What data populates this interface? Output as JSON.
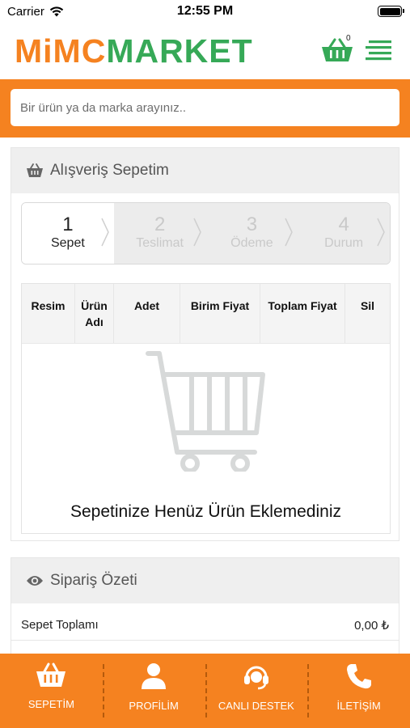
{
  "status_bar": {
    "carrier": "Carrier",
    "time": "12:55 PM"
  },
  "header": {
    "logo": {
      "part1": "MiMC",
      "part2": "MARKET"
    },
    "cart_count": "0",
    "icons": {
      "cart": "basket-icon",
      "menu": "menu-icon"
    }
  },
  "search": {
    "placeholder": "Bir ürün ya da marka arayınız.."
  },
  "cart": {
    "title": "Alışveriş Sepetim",
    "steps": [
      {
        "number": "1",
        "label": "Sepet",
        "active": true
      },
      {
        "number": "2",
        "label": "Teslimat",
        "active": false
      },
      {
        "number": "3",
        "label": "Ödeme",
        "active": false
      },
      {
        "number": "4",
        "label": "Durum",
        "active": false
      }
    ],
    "table_headers": [
      "Resim",
      "Ürün Adı",
      "Adet",
      "Birim Fiyat",
      "Toplam Fiyat",
      "Sil"
    ],
    "empty_message": "Sepetinize Henüz Ürün Eklemediniz"
  },
  "summary": {
    "title": "Sipariş Özeti",
    "rows": [
      {
        "label": "Sepet Toplamı",
        "value": "0,00 ₺"
      }
    ]
  },
  "bottom_nav": [
    {
      "label": "SEPETİM",
      "icon": "basket-icon"
    },
    {
      "label": "PROFİLİM",
      "icon": "user-icon"
    },
    {
      "label": "CANLI DESTEK",
      "icon": "headset-icon"
    },
    {
      "label": "İLETİŞİM",
      "icon": "phone-icon"
    }
  ],
  "colors": {
    "brand_orange": "#f58220",
    "brand_green": "#36a957"
  }
}
